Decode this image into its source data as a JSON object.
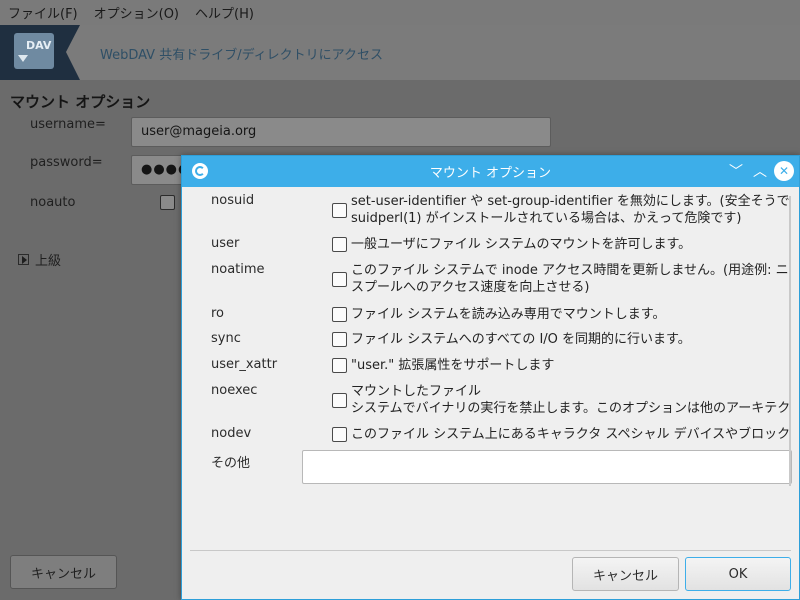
{
  "menubar": {
    "items": [
      "ファイル(F)",
      "オプション(O)",
      "ヘルプ(H)"
    ]
  },
  "banner": {
    "logo_text": "DAV",
    "title": "WebDAV 共有ドライブ/ディレクトリにアクセス"
  },
  "main": {
    "section_title": "マウント オプション",
    "username_label": "username=",
    "username_value": "user@mageia.org",
    "password_label": "password=",
    "password_value": "●●●●",
    "noauto_label": "noauto",
    "advanced_label": "上級",
    "cancel_label": "キャンセル"
  },
  "dialog": {
    "title": "マウント オプション",
    "icons": {
      "minimize": "chevron-down-icon",
      "maximize": "chevron-up-icon",
      "close": "close-icon"
    },
    "options": [
      {
        "name": "nosuid",
        "desc": "set-user-identifier や set-group-identifier を無効にします。(安全そうで",
        "desc2": "suidperl(1) がインストールされている場合は、かえって危険です)"
      },
      {
        "name": "user",
        "desc": "一般ユーザにファイル システムのマウントを許可します。",
        "desc2": ""
      },
      {
        "name": "noatime",
        "desc": "このファイル システムで inode アクセス時間を更新しません。(用途例: ニ",
        "desc2": "スプールへのアクセス速度を向上させる)"
      },
      {
        "name": "ro",
        "desc": "ファイル システムを読み込み専用でマウントします。",
        "desc2": ""
      },
      {
        "name": "sync",
        "desc": "ファイル システムへのすべての I/O を同期的に行います。",
        "desc2": ""
      },
      {
        "name": "user_xattr",
        "desc": "\"user.\" 拡張属性をサポートします",
        "desc2": ""
      },
      {
        "name": "noexec",
        "desc": "マウントしたファイル",
        "desc2": "システムでバイナリの実行を禁止します。このオプションは他のアーキテク"
      },
      {
        "name": "nodev",
        "desc": "このファイル システム上にあるキャラクタ スペシャル デバイスやブロック",
        "desc2": ""
      }
    ],
    "other_label": "その他",
    "other_value": "",
    "cancel_label": "キャンセル",
    "ok_label": "OK"
  },
  "colors": {
    "titlebar": "#3daee9",
    "dim_background": "#6b6b6b",
    "dialog_background": "#efefef"
  }
}
